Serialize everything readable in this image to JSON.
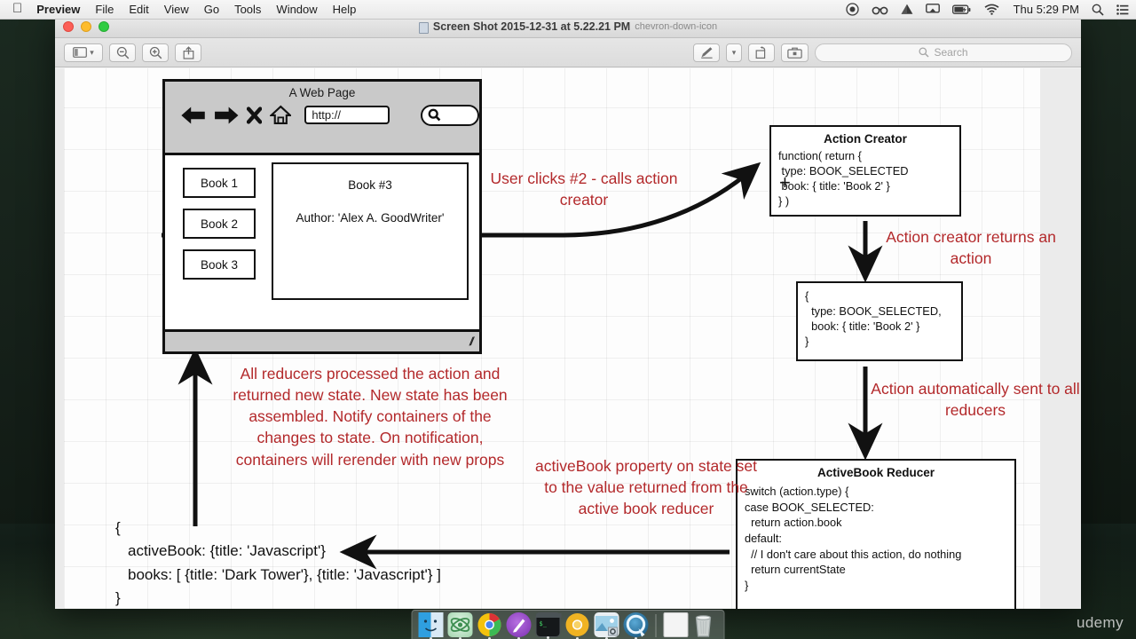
{
  "menu_bar": {
    "apple_icon": "apple-icon",
    "items": [
      "Preview",
      "File",
      "Edit",
      "View",
      "Go",
      "Tools",
      "Window",
      "Help"
    ],
    "status_icons": [
      "record-icon",
      "glasses-icon",
      "google-drive-icon",
      "airplay-icon",
      "battery-charging-icon",
      "wifi-icon"
    ],
    "clock": "Thu 5:29 PM",
    "right_icons": [
      "spotlight-search-icon",
      "notification-center-icon"
    ]
  },
  "window": {
    "title": "Screen Shot 2015-12-31 at 5.22.21 PM",
    "title_icon": "preview-document-icon",
    "title_chevron": "chevron-down-icon",
    "traffic_lights": [
      "close-button",
      "minimize-button",
      "zoom-button"
    ],
    "toolbar": {
      "sidebar_icon": "sidebar-icon",
      "sidebar_chevron": "chevron-down-icon",
      "zoom_out_icon": "zoom-out-icon",
      "zoom_in_icon": "zoom-in-icon",
      "share_icon": "share-icon",
      "markup_icon": "markup-pen-icon",
      "markup_chevron": "chevron-down-icon",
      "rotate_icon": "rotate-left-icon",
      "toolkit_icon": "markup-toolbox-icon",
      "search_icon": "search-icon",
      "search_placeholder": "Search",
      "search_value": ""
    }
  },
  "browser_mock": {
    "title": "A Web Page",
    "icons": [
      "back-arrow-icon",
      "forward-arrow-icon",
      "stop-x-icon",
      "home-icon"
    ],
    "url_value": "http://",
    "search_icon": "search-icon",
    "book_buttons": [
      "Book 1",
      "Book 2",
      "Book 3"
    ],
    "detail_title": "Book #3",
    "detail_author": "Author: 'Alex A. GoodWriter'",
    "resize_grip": "resize-grip-icon"
  },
  "diagram": {
    "cursor_glyph": "+",
    "action_creator": {
      "title": "Action Creator",
      "code": "function( return {\n type: BOOK_SELECTED\n book: { title: 'Book 2' }\n} )"
    },
    "action_object": {
      "code": "{\n  type: BOOK_SELECTED,\n  book: { title: 'Book 2' }\n}"
    },
    "reducer": {
      "title": "ActiveBook Reducer",
      "code": "switch (action.type) {\ncase BOOK_SELECTED:\n  return action.book\ndefault:\n  // I don't care about this action, do nothing\n  return currentState\n}"
    },
    "state_object": {
      "line1": "{",
      "line2": "activeBook: {title: 'Javascript'}",
      "line3": "books: [ {title: 'Dark Tower'}, {title: 'Javascript'} ]",
      "line4": "}"
    },
    "notes": {
      "note_1": "User clicks #2 - calls action creator",
      "note_2": "Action creator returns an action",
      "note_3": "Action automatically sent to all reducers",
      "note_4": "activeBook property on state set to the value returned from the active book reducer",
      "note_5": "All reducers processed the action and returned new state.  New state has been assembled.  Notify containers of the changes to state. On notification, containers will rerender with new props"
    },
    "colors": {
      "annotation_red": "#b3292b",
      "ink_black": "#111111",
      "chrome_gray": "#c9c9c9"
    }
  },
  "dock": {
    "items": [
      "finder-icon",
      "atom-icon",
      "chrome-icon",
      "postman-icon",
      "terminal-icon",
      "chrome-canary-icon",
      "preview-icon",
      "quicktime-icon"
    ],
    "separator": "dock-separator",
    "right_items": [
      "documents-stack-icon",
      "trash-icon"
    ]
  },
  "watermark": "udemy"
}
